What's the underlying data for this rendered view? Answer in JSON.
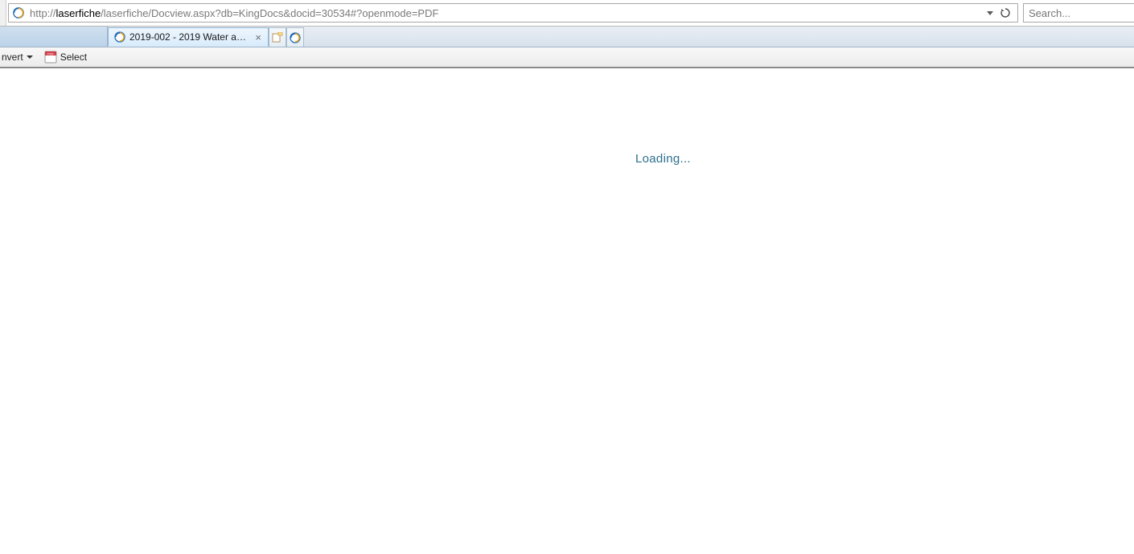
{
  "address_bar": {
    "url_pre": "http://",
    "url_host": "laserfiche",
    "url_rest": "/laserfiche/Docview.aspx?db=KingDocs&docid=30534#?openmode=PDF"
  },
  "search": {
    "placeholder": "Search..."
  },
  "tabs": {
    "active": {
      "title": "2019-002 - 2019 Water and ..."
    }
  },
  "toolbar": {
    "convert_label": "nvert",
    "select_label": "Select"
  },
  "page": {
    "loading_text": "Loading..."
  }
}
